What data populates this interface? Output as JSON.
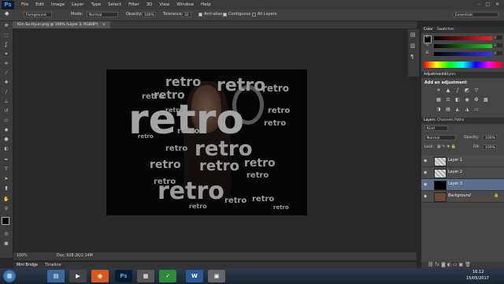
{
  "menubar": {
    "logo": "Ps",
    "items": [
      "File",
      "Edit",
      "Image",
      "Layer",
      "Type",
      "Select",
      "Filter",
      "3D",
      "View",
      "Window",
      "Help"
    ]
  },
  "options": {
    "fill_source": "Foreground",
    "mode_label": "Mode:",
    "mode_value": "Normal",
    "opacity_label": "Opacity:",
    "opacity_value": "100%",
    "tolerance_label": "Tolerance:",
    "tolerance_value": "32",
    "antialias_label": "Anti-alias",
    "contiguous_label": "Contiguous",
    "all_layers_label": "All Layers",
    "workspace": "Essentials"
  },
  "document": {
    "tab_title": "Kim-So-Hyun.png @ 100% (Layer 3, RGB/8*)",
    "tab_close": "×"
  },
  "status": {
    "zoom": "100%",
    "doc_size": "Doc: 628.2K/2.14M"
  },
  "bottom_tabs": [
    "Mini Bridge",
    "Timeline"
  ],
  "color_panel": {
    "tabs": [
      "Color",
      "Swatches"
    ],
    "channels": [
      {
        "label": "R",
        "value": "0"
      },
      {
        "label": "G",
        "value": "0"
      },
      {
        "label": "B",
        "value": "0"
      }
    ]
  },
  "adjustments_panel": {
    "tabs": [
      "Adjustments",
      "Styles"
    ],
    "heading": "Add an adjustment"
  },
  "layers_panel": {
    "tabs": [
      "Layers",
      "Channels",
      "Paths"
    ],
    "kind_label": "Kind",
    "blend_mode": "Normal",
    "opacity_label": "Opacity:",
    "opacity_value": "100%",
    "lock_label": "Lock:",
    "fill_label": "Fill:",
    "fill_value": "100%",
    "layers": [
      {
        "name": "Layer 1",
        "selected": false
      },
      {
        "name": "Layer 2",
        "selected": false
      },
      {
        "name": "Layer 3",
        "selected": true
      },
      {
        "name": "Background",
        "selected": false
      }
    ]
  },
  "canvas_text": {
    "word": "retro",
    "big": "retro"
  },
  "taskbar": {
    "time": "16:12",
    "date": "15/05/2017"
  },
  "colors": {
    "accent": "#3fa7f5",
    "selected_layer": "#5b6f8c"
  },
  "icons": [
    "move-icon",
    "marquee-icon",
    "lasso-icon",
    "magic-wand-icon",
    "crop-icon",
    "eyedropper-icon",
    "healing-icon",
    "brush-icon",
    "stamp-icon",
    "history-brush-icon",
    "eraser-icon",
    "paint-bucket-icon",
    "blur-icon",
    "dodge-icon",
    "pen-icon",
    "type-icon",
    "path-select-icon",
    "shape-icon",
    "hand-icon",
    "zoom-icon"
  ]
}
